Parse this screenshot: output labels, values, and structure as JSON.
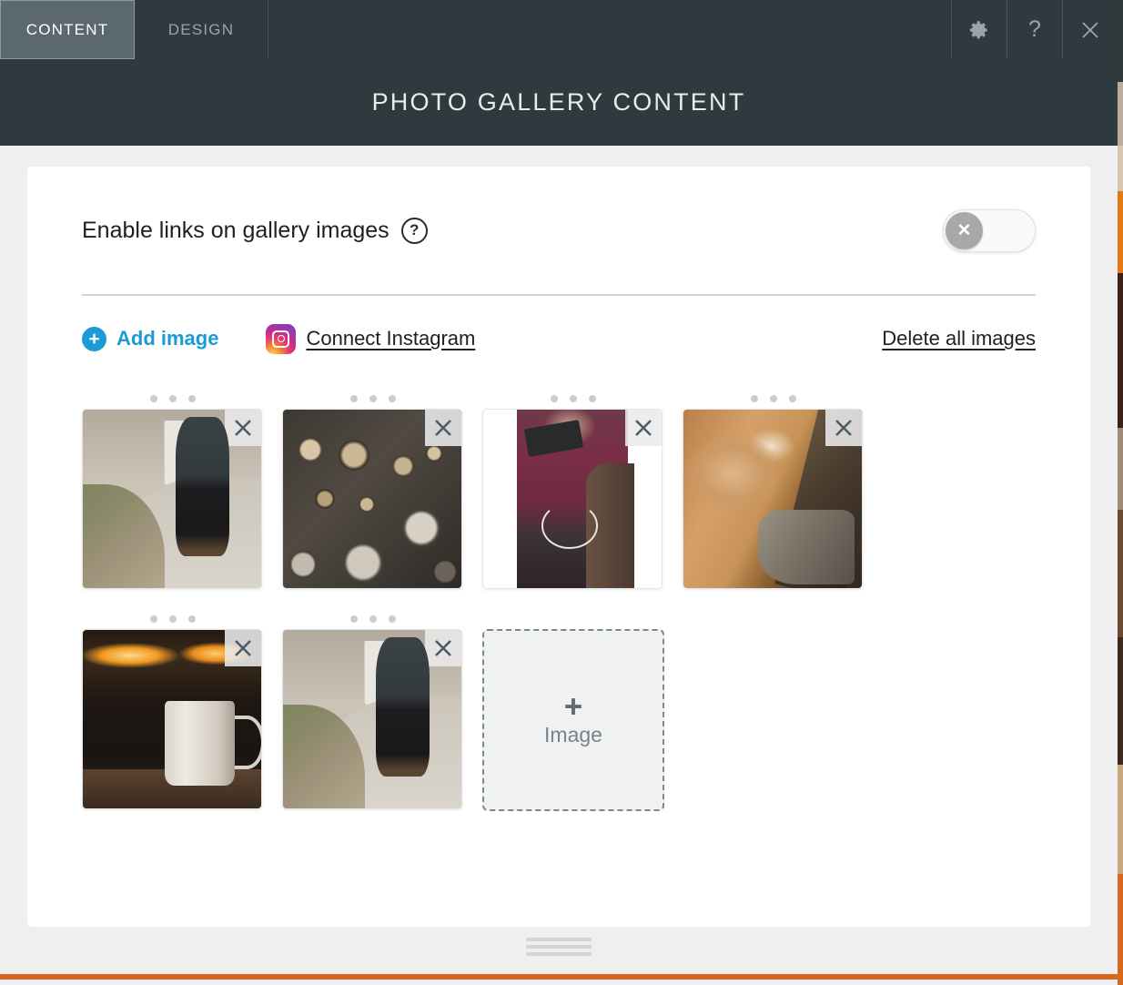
{
  "window": {
    "tabs": [
      {
        "label": "CONTENT",
        "active": true
      },
      {
        "label": "DESIGN",
        "active": false
      }
    ],
    "icons": {
      "settings": "gear-icon",
      "help": "?",
      "close": "close-icon"
    },
    "title": "PHOTO GALLERY CONTENT"
  },
  "settings": {
    "enable_links_label": "Enable links on gallery images",
    "help_glyph": "?",
    "toggle": {
      "state": "off",
      "knob_glyph": "✕"
    }
  },
  "toolbar": {
    "add_image_label": "Add image",
    "add_image_glyph": "+",
    "connect_instagram_label": "Connect Instagram",
    "delete_all_label": "Delete all images"
  },
  "gallery": {
    "images": [
      {
        "alt": "woman-walking-on-path",
        "art": "ph-walk",
        "letterbox": false,
        "delete_label": "✕"
      },
      {
        "alt": "stacked-firewood-logs",
        "art": "ph-logs",
        "letterbox": false,
        "delete_label": "✕"
      },
      {
        "alt": "woman-in-maroon-sweater-with-earbuds",
        "art": "ph-portrait",
        "letterbox": true,
        "delete_label": "✕"
      },
      {
        "alt": "dog-lying-on-wood-floor-with-boots",
        "art": "ph-dog",
        "letterbox": false,
        "delete_label": "✕"
      },
      {
        "alt": "white-mug-by-fireplace",
        "art": "ph-mug",
        "letterbox": false,
        "delete_label": "✕"
      },
      {
        "alt": "woman-walking-on-path",
        "art": "ph-walk",
        "letterbox": false,
        "delete_label": "✕"
      }
    ],
    "placeholder": {
      "plus_glyph": "+",
      "label": "Image"
    }
  },
  "colors": {
    "header_bg": "#2f3a3e",
    "active_tab_bg": "#5b686e",
    "accent_blue": "#1c9ad6",
    "panel_bg": "#ffffff",
    "modal_bg": "#efefef",
    "bottom_accent": "#d2691e",
    "divider": "#ced4d8"
  }
}
